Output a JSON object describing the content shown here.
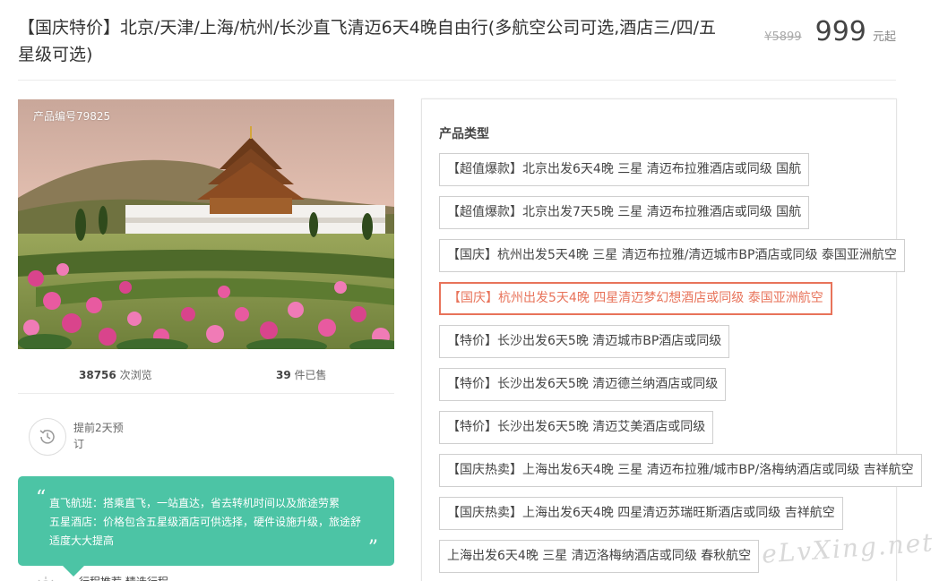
{
  "product": {
    "title": "【国庆特价】北京/天津/上海/杭州/长沙直飞清迈6天4晚自由行(多航空公司可选,酒店三/四/五星级可选)",
    "old_price": "¥5899",
    "price": "999",
    "price_unit": "元起",
    "product_no": "产品编号79825"
  },
  "stats": {
    "views": "38756",
    "views_label": "次浏览",
    "sold": "39",
    "sold_label": "件已售"
  },
  "booking": {
    "text": "提前2天预订",
    "icon": "clock-history-icon"
  },
  "tip": {
    "lines": [
      "直飞航班：搭乘直飞，一站直达，省去转机时间以及旅途劳累",
      "五星酒店：价格包含五星级酒店可供选择，硬件设施升级，旅途舒",
      "适度大大提高"
    ],
    "open_quote": "“",
    "close_quote": "”"
  },
  "bottom_partial": {
    "text": "行程推荐 精选行程"
  },
  "panel": {
    "label": "产品类型",
    "options": [
      "【超值爆款】北京出发6天4晚 三星 清迈布拉雅酒店或同级 国航",
      "【超值爆款】北京出发7天5晚 三星 清迈布拉雅酒店或同级 国航",
      "【国庆】杭州出发5天4晚 三星 清迈布拉雅/清迈城市BP酒店或同级 泰国亚洲航空",
      "【国庆】杭州出发5天4晚 四星清迈梦幻想酒店或同级 泰国亚洲航空",
      "【特价】长沙出发6天5晚 清迈城市BP酒店或同级",
      "【特价】长沙出发6天5晚 清迈德兰纳酒店或同级",
      "【特价】长沙出发6天5晚 清迈艾美酒店或同级",
      "【国庆热卖】上海出发6天4晚 三星 清迈布拉雅/城市BP/洛梅纳酒店或同级 吉祥航空",
      "【国庆热卖】上海出发6天4晚 四星清迈苏瑞旺斯酒店或同级 吉祥航空",
      "上海出发6天4晚 三星 清迈洛梅纳酒店或同级 春秋航空"
    ],
    "selected_index": 3
  },
  "watermark": "eLvXing.net",
  "colors": {
    "accent_green": "#4cc4a5",
    "selected_orange": "#e8735a"
  }
}
